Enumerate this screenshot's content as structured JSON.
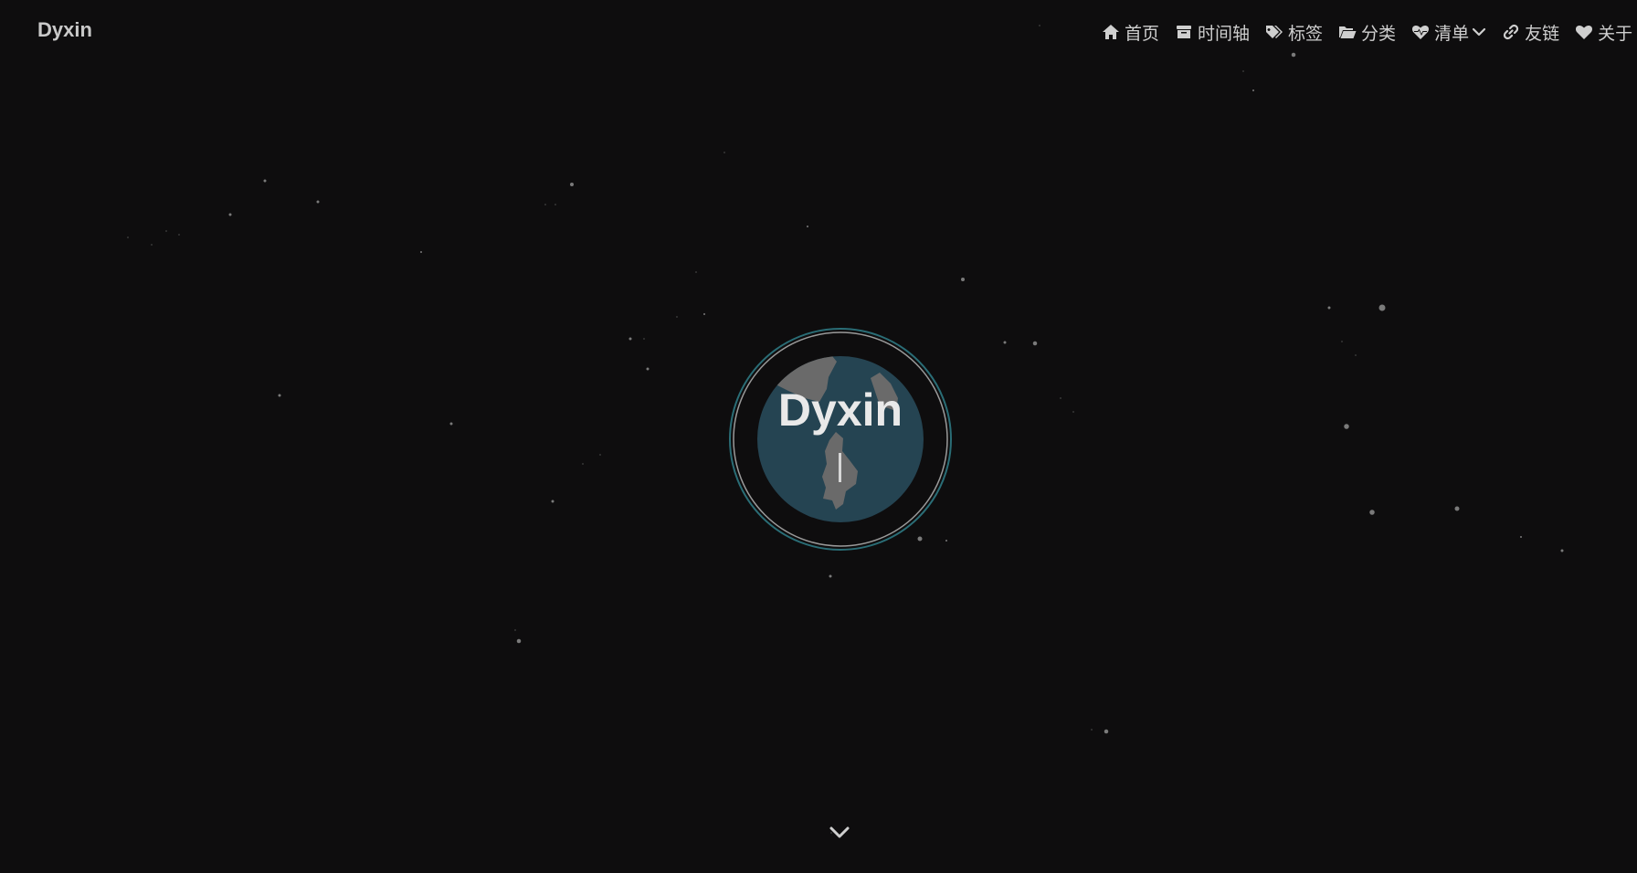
{
  "site": {
    "brand": "Dyxin"
  },
  "nav": {
    "items": [
      {
        "label": "首页",
        "icon": "home-icon"
      },
      {
        "label": "时间轴",
        "icon": "archive-icon"
      },
      {
        "label": "标签",
        "icon": "tags-icon"
      },
      {
        "label": "分类",
        "icon": "folder-open-icon"
      },
      {
        "label": "清单",
        "icon": "heartbeat-icon",
        "has_dropdown": true
      },
      {
        "label": "友链",
        "icon": "link-icon"
      },
      {
        "label": "关于",
        "icon": "heart-icon"
      }
    ]
  },
  "hero": {
    "title": "Dyxin",
    "planet_ocean_color": "#254452",
    "planet_land_color": "#6a6a6a",
    "ring_color": "#2a6d76"
  },
  "scroll_hint": {
    "icon": "chevron-down-icon"
  },
  "colors": {
    "background": "#0e0d0e",
    "star": "#7a7a7a",
    "text": "#cfcfcf"
  }
}
